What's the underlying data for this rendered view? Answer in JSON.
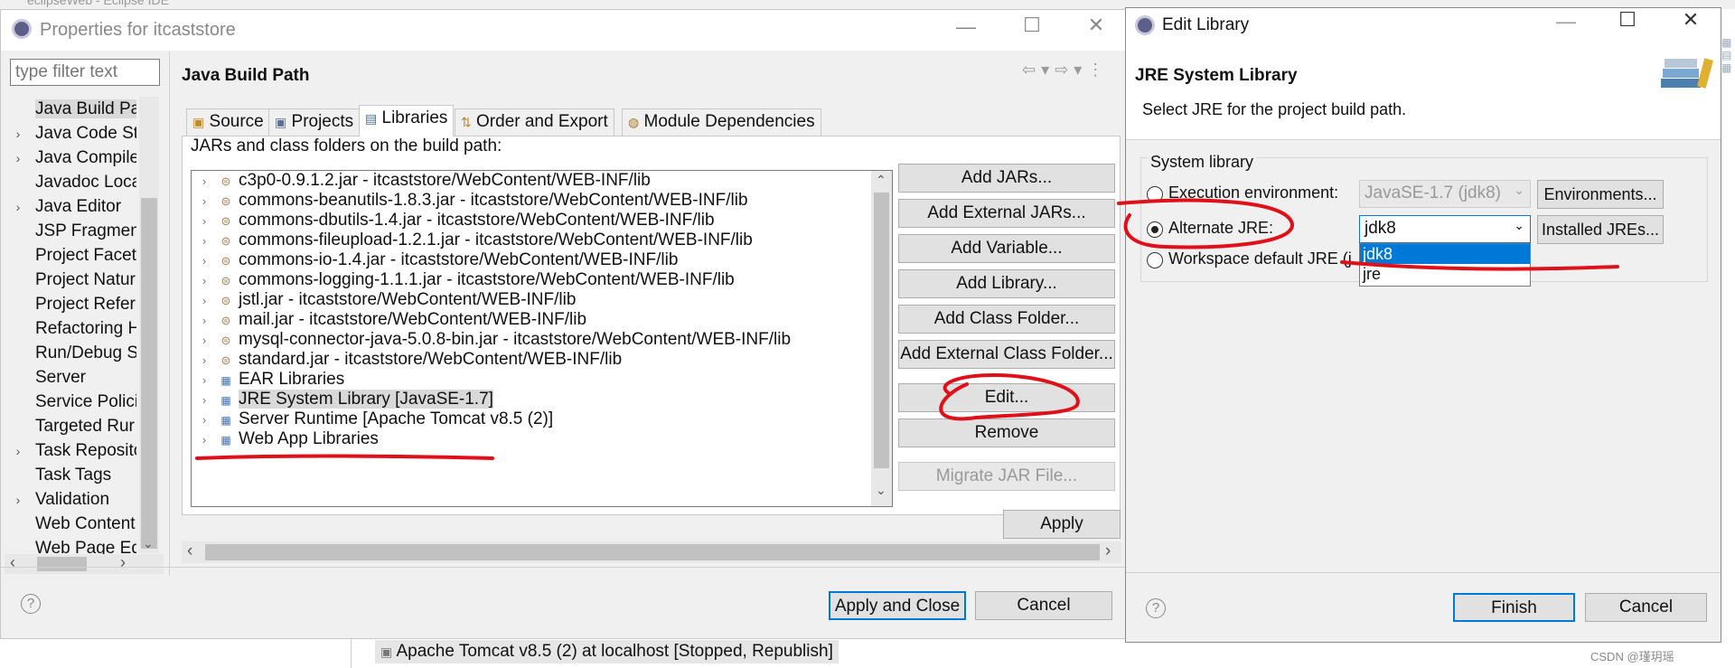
{
  "eclipse_window": {
    "title": "eclipseWeb - Eclipse IDE"
  },
  "properties_dialog": {
    "title": "Properties for itcaststore",
    "filter_placeholder": "type filter text",
    "nav_items": [
      {
        "label": "Java Build Pa",
        "expandable": false,
        "selected": true
      },
      {
        "label": "Java Code Sty",
        "expandable": true
      },
      {
        "label": "Java Compile",
        "expandable": true
      },
      {
        "label": "Javadoc Loca",
        "expandable": false
      },
      {
        "label": "Java Editor",
        "expandable": true
      },
      {
        "label": "JSP Fragmen",
        "expandable": false
      },
      {
        "label": "Project Facet",
        "expandable": false
      },
      {
        "label": "Project Natur",
        "expandable": false
      },
      {
        "label": "Project Refer",
        "expandable": false
      },
      {
        "label": "Refactoring H",
        "expandable": false
      },
      {
        "label": "Run/Debug S",
        "expandable": false
      },
      {
        "label": "Server",
        "expandable": false
      },
      {
        "label": "Service Polici",
        "expandable": false
      },
      {
        "label": "Targeted Rur",
        "expandable": false
      },
      {
        "label": "Task Reposito",
        "expandable": true
      },
      {
        "label": "Task Tags",
        "expandable": false
      },
      {
        "label": "Validation",
        "expandable": true
      },
      {
        "label": "Web Content",
        "expandable": false
      },
      {
        "label": "Web Page Ed",
        "expandable": false
      }
    ],
    "panel_title": "Java Build Path",
    "tabs": [
      "Source",
      "Projects",
      "Libraries",
      "Order and Export",
      "Module Dependencies"
    ],
    "active_tab": "Libraries",
    "list_label": "JARs and class folders on the build path:",
    "entries": [
      {
        "label": "c3p0-0.9.1.2.jar - itcaststore/WebContent/WEB-INF/lib",
        "icon": "jar-icon"
      },
      {
        "label": "commons-beanutils-1.8.3.jar - itcaststore/WebContent/WEB-INF/lib",
        "icon": "jar-icon"
      },
      {
        "label": "commons-dbutils-1.4.jar - itcaststore/WebContent/WEB-INF/lib",
        "icon": "jar-icon"
      },
      {
        "label": "commons-fileupload-1.2.1.jar - itcaststore/WebContent/WEB-INF/lib",
        "icon": "jar-icon"
      },
      {
        "label": "commons-io-1.4.jar - itcaststore/WebContent/WEB-INF/lib",
        "icon": "jar-icon"
      },
      {
        "label": "commons-logging-1.1.1.jar - itcaststore/WebContent/WEB-INF/lib",
        "icon": "jar-icon"
      },
      {
        "label": "jstl.jar - itcaststore/WebContent/WEB-INF/lib",
        "icon": "jar-icon"
      },
      {
        "label": "mail.jar - itcaststore/WebContent/WEB-INF/lib",
        "icon": "jar-icon"
      },
      {
        "label": "mysql-connector-java-5.0.8-bin.jar - itcaststore/WebContent/WEB-INF/lib",
        "icon": "jar-icon"
      },
      {
        "label": "standard.jar - itcaststore/WebContent/WEB-INF/lib",
        "icon": "jar-icon"
      },
      {
        "label": "EAR Libraries",
        "icon": "library-icon"
      },
      {
        "label": "JRE System Library [JavaSE-1.7]",
        "icon": "library-icon",
        "selected": true
      },
      {
        "label": "Server Runtime [Apache Tomcat v8.5 (2)]",
        "icon": "library-icon"
      },
      {
        "label": "Web App Libraries",
        "icon": "library-icon"
      }
    ],
    "buttons": {
      "add_jars": "Add JARs...",
      "add_external_jars": "Add External JARs...",
      "add_variable": "Add Variable...",
      "add_library": "Add Library...",
      "add_class_folder": "Add Class Folder...",
      "add_external_class_folder": "Add External Class Folder...",
      "edit": "Edit...",
      "remove": "Remove",
      "migrate": "Migrate JAR File...",
      "apply": "Apply",
      "apply_and_close": "Apply and Close",
      "cancel": "Cancel"
    }
  },
  "edit_library_dialog": {
    "title": "Edit Library",
    "banner_title": "JRE System Library",
    "banner_description": "Select JRE for the project build path.",
    "group_label": "System library",
    "execution_env_label": "Execution environment:",
    "execution_env_value": "JavaSE-1.7 (jdk8)",
    "environments_button": "Environments...",
    "alternate_jre_label": "Alternate JRE:",
    "alternate_jre_value": "jdk8",
    "installed_jres_button": "Installed JREs...",
    "workspace_default_label": "Workspace default JRE (j",
    "dropdown_options": [
      "jdk8",
      "jre"
    ],
    "highlighted_option": "jdk8",
    "selected_radio": "alternate",
    "finish_button": "Finish",
    "cancel_button": "Cancel"
  },
  "background_status": {
    "server_entry": "Apache Tomcat v8.5 (2) at localhost  [Stopped, Republish]"
  },
  "watermark": "CSDN @瑾玥瑶",
  "colors": {
    "annotation_red": "#e0101a",
    "selection_blue": "#0078d7",
    "dialog_bg": "#f0f0f0"
  }
}
